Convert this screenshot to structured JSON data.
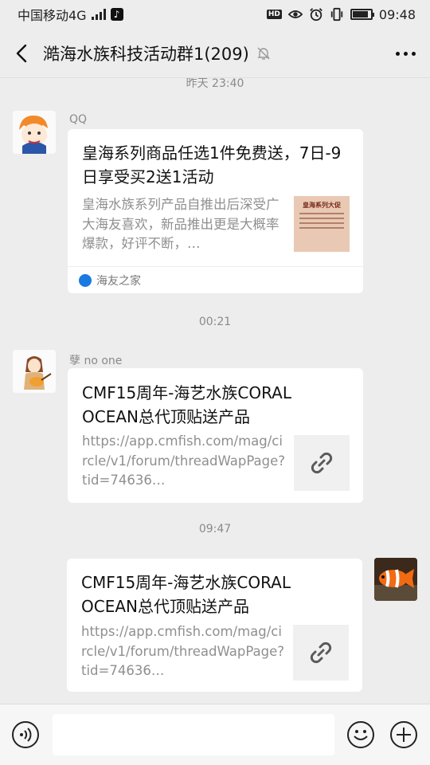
{
  "status_bar": {
    "carrier": "中国移动4G",
    "network": "4G",
    "time": "09:48",
    "hd_label": "HD",
    "battery_level": 0.85,
    "icons": [
      "signal-icon",
      "tiktok-icon",
      "hd-icon",
      "eye-icon",
      "alarm-icon",
      "vibrate-icon",
      "battery-icon"
    ]
  },
  "header": {
    "title": "澔海水族科技活动群1(209)",
    "icons": [
      "back-arrow-icon",
      "mute-bell-icon",
      "more-dots-icon"
    ]
  },
  "messages": [
    {
      "timestamp": "昨天 23:40",
      "sender": "QQ",
      "title": "皇海系列商品任选1件免费送，7日-9日享受买2送1活动",
      "description": "皇海水族系列产品自推出后深受广大海友喜欢，新品推出更是大概率爆款，好评不断，…",
      "thumbnail_text": "皇海系列大促",
      "source": "海友之家",
      "align": "left"
    },
    {
      "timestamp": "00:21",
      "sender": "孽 no one",
      "title": "CMF15周年-海艺水族CORAL OCEAN总代顶贴送产品",
      "description": "https://app.cmfish.com/mag/circle/v1/forum/threadWapPage?tid=74636…",
      "thumbnail_icon": "link-icon",
      "align": "left"
    },
    {
      "timestamp": "09:47",
      "title": "CMF15周年-海艺水族CORAL OCEAN总代顶贴送产品",
      "description": "https://app.cmfish.com/mag/circle/v1/forum/threadWapPage?tid=74636…",
      "thumbnail_icon": "link-icon",
      "align": "right"
    }
  ],
  "input_bar": {
    "placeholder": "",
    "icons": [
      "voice-icon",
      "emoji-icon",
      "plus-icon"
    ]
  }
}
